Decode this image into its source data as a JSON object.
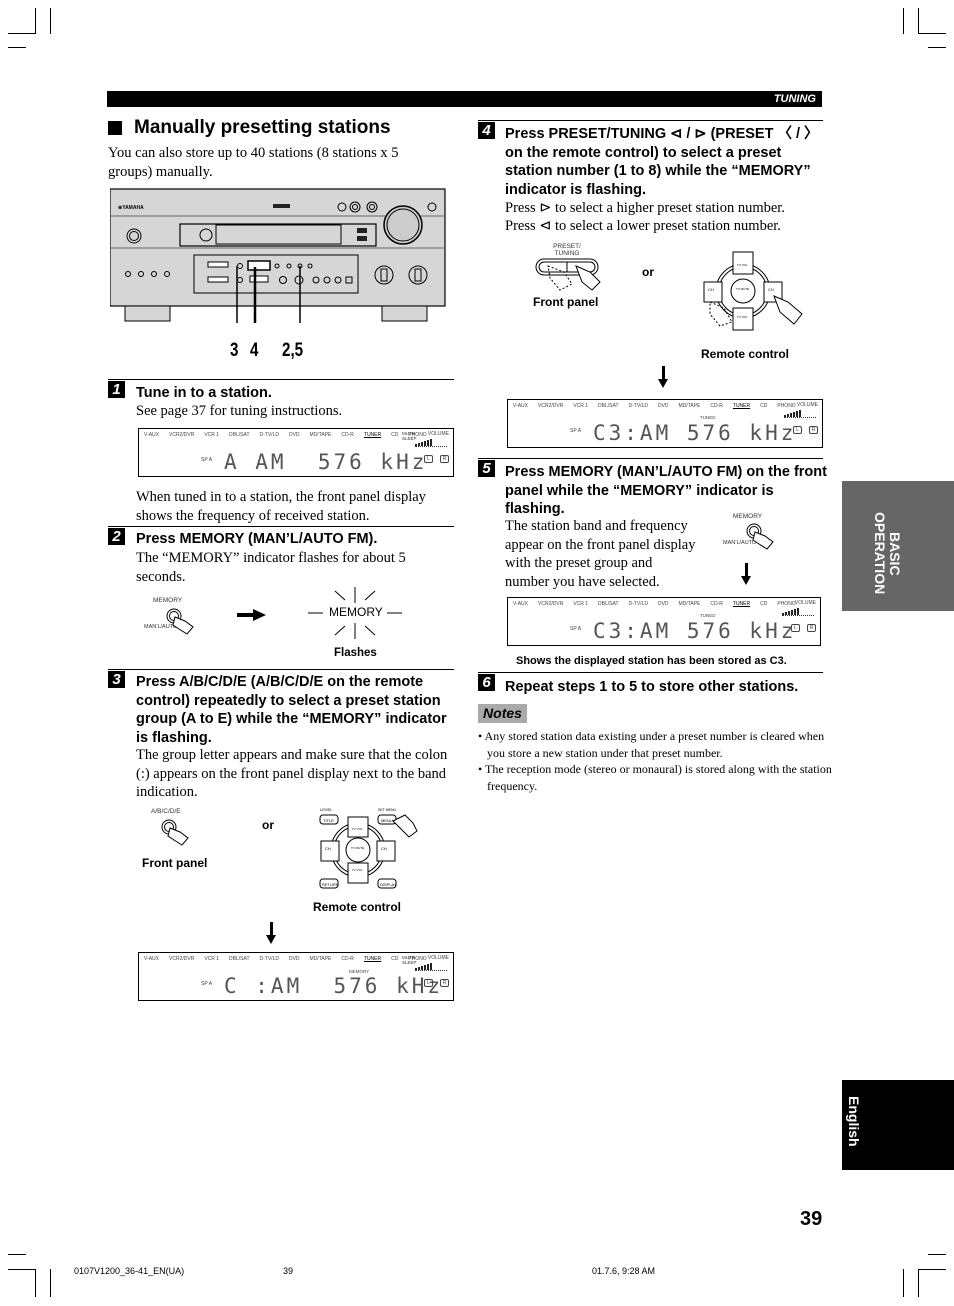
{
  "header": {
    "section": "TUNING"
  },
  "title": "Manually presetting stations",
  "intro": "You can also store up to 40 stations (8 stations x 5 groups) manually.",
  "receiver": {
    "brand": "YAMAHA",
    "callouts": [
      "3",
      "4",
      "2,5"
    ]
  },
  "display": {
    "sources": [
      "V-AUX",
      "VCR2/DVR",
      "VCR 1",
      "DBL/SAT",
      "D-TV/LD",
      "DVD",
      "MD/TAPE",
      "CD-R",
      "TUNER",
      "CD",
      "PHONO"
    ],
    "active_source": "TUNER",
    "mute_sleep": "MUTE SLEEP",
    "volume_label": "VOLUME",
    "sp_label": "SP A",
    "left_label": "L",
    "right_label": "R",
    "tuned_label": "TUNED",
    "memory_label": "MEMORY"
  },
  "steps": [
    {
      "num": "1",
      "heading": "Tune in to a station.",
      "body": "See page 37 for tuning instructions.",
      "display_text": "A AM  576 kHz",
      "after": "When tuned in to a station, the front panel display shows the frequency of received station."
    },
    {
      "num": "2",
      "heading": "Press MEMORY (MAN’L/AUTO FM).",
      "body": "The “MEMORY” indicator flashes for about 5 seconds.",
      "button_top": "MEMORY",
      "button_bottom": "MAN’L/AUTO",
      "indicator": "MEMORY",
      "caption": "Flashes"
    },
    {
      "num": "3",
      "heading": "Press A/B/C/D/E (A/B/C/D/E on the remote control) repeatedly to select a preset station group (A to E) while the “MEMORY” indicator is flashing.",
      "body": "The group letter appears and make sure that the colon (:) appears on the front panel display next to the band indication.",
      "button_label": "A/B/C/D/E",
      "or": "or",
      "front_caption": "Front panel",
      "remote_caption": "Remote control",
      "remote_labels": [
        "LEVEL",
        "TITLE",
        "TV INPUT",
        "SET MENU",
        "MENU",
        "A/B/C/D/E",
        "TV VOL",
        "CH",
        "TV MUTE SELECT",
        "PRESET",
        "TEST",
        "RETURN",
        "ON SCREEN",
        "DISPLAY"
      ],
      "display_text": "C :AM  576 kHz"
    },
    {
      "num": "4",
      "heading": "Press PRESET/TUNING ⊲ / ⊳ (PRESET 〈 / 〉 on the remote control) to select a preset station number (1 to 8) while the “MEMORY” indicator is flashing.",
      "body_lines": [
        "Press ⊳ to select a higher preset station number.",
        "Press ⊲ to select a lower preset station number."
      ],
      "button_label": "PRESET/ TUNING",
      "or": "or",
      "front_caption": "Front panel",
      "remote_caption": "Remote control",
      "remote_labels": [
        "TV VOL",
        "CH",
        "TV MUTE SELECT",
        "PRESET"
      ],
      "display_text": "C3:AM 576 kHz"
    },
    {
      "num": "5",
      "heading": "Press MEMORY (MAN’L/AUTO FM) on the front panel while the “MEMORY” indicator is flashing.",
      "body": "The station band and frequency appear on the front panel display with the preset group and number you have selected.",
      "button_top": "MEMORY",
      "button_bottom": "MAN’L/AUTO",
      "display_text": "C3:AM 576 kHz",
      "caption": "Shows the displayed station has been stored as C3."
    },
    {
      "num": "6",
      "heading": "Repeat steps 1 to 5 to store other stations."
    }
  ],
  "notes": {
    "title": "Notes",
    "items": [
      "Any stored station data existing under a preset number is cleared when you store a new station under that preset number.",
      "The reception mode (stereo or monaural) is stored along with the station frequency."
    ]
  },
  "side_tabs": {
    "basic": "BASIC OPERATION",
    "language": "English"
  },
  "page_number": "39",
  "footer": {
    "file": "0107V1200_36-41_EN(UA)",
    "page": "39",
    "timestamp": "01.7.6, 9:28 AM"
  }
}
